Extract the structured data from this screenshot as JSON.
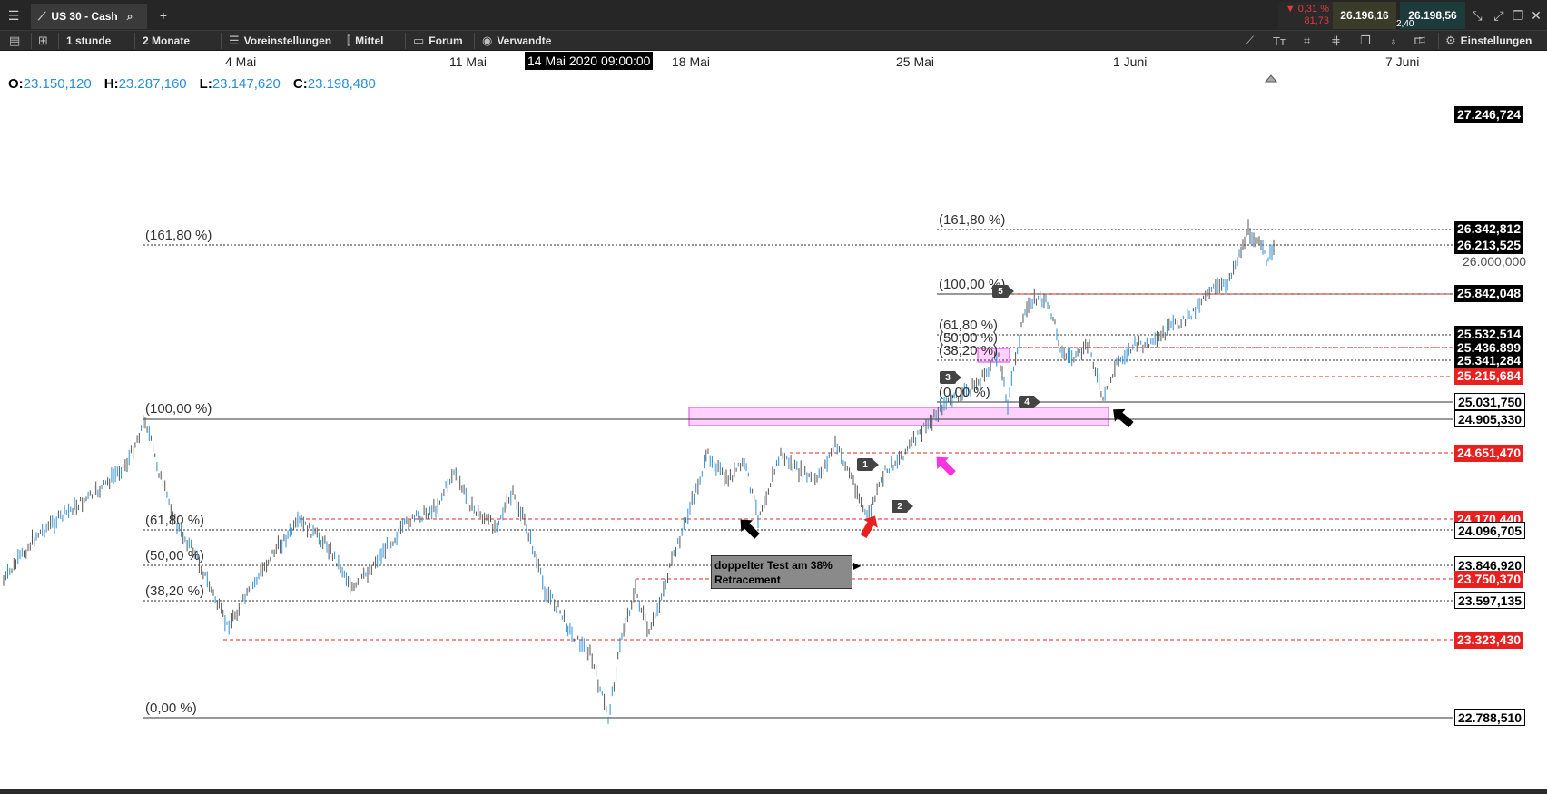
{
  "window": {
    "tab_title": "US 30 - Cash",
    "add_tab": "+",
    "change_percent": "▼ 0,31 %",
    "change_abs": "81,73",
    "bid": "26.196,16",
    "spread": "2,40",
    "ask": "26.198,56"
  },
  "toolbar": {
    "interval": "1 stunde",
    "range": "2 Monate",
    "presets": "Voreinstellungen",
    "candles": "Mittel",
    "forum": "Forum",
    "related": "Verwandte",
    "settings": "Einstellungen"
  },
  "date_axis": {
    "labels": [
      "4 Mai",
      "11 Mai",
      "18 Mai",
      "25 Mai",
      "1 Juni",
      "7 Juni"
    ],
    "crosshair": "14 Mai 2020 09:00:00"
  },
  "ohlc": {
    "o_label": "O:",
    "o": "23.150,120",
    "h_label": "H:",
    "h": "23.287,160",
    "l_label": "L:",
    "l": "23.147,620",
    "c_label": "C:",
    "c": "23.198,480"
  },
  "fib_left": [
    "(161,80 %)",
    "(100,00 %)",
    "(61,80 %)",
    "(50,00 %)",
    "(38,20 %)",
    "(0,00 %)"
  ],
  "fib_right": [
    "(161,80 %)",
    "(100,00 %)",
    "(61,80 %)",
    "(50,00 %)",
    "(38,20 %)",
    "(0,00 %)"
  ],
  "price_labels": {
    "top": "27.246,724",
    "p1": "26.342,812",
    "p2": "26.213,525",
    "p3": "26.000,000",
    "p4": "25.842,048",
    "p5": "25.532,514",
    "p6": "25.436,899",
    "p7": "25.341,284",
    "p8": "25.215,684",
    "p9": "25.031,750",
    "p10": "24.905,330",
    "p11": "24.651,470",
    "p12": "24.170,440",
    "p13": "24.096,705",
    "p14": "23.846,920",
    "p15": "23.750,370",
    "p16": "23.597,135",
    "p17": "23.323,430",
    "p18": "22.788,510"
  },
  "annotation": {
    "line1": "doppelter Test am 38%",
    "line2": "Retracement"
  },
  "wave_tags": [
    "1",
    "2",
    "3",
    "4",
    "5"
  ],
  "colors": {
    "candle": "#2a8fd6",
    "support": "#e82020",
    "zone": "#ff66ff",
    "arrow_black": "#000000",
    "arrow_red": "#e82020",
    "arrow_magenta": "#ff33dd"
  }
}
